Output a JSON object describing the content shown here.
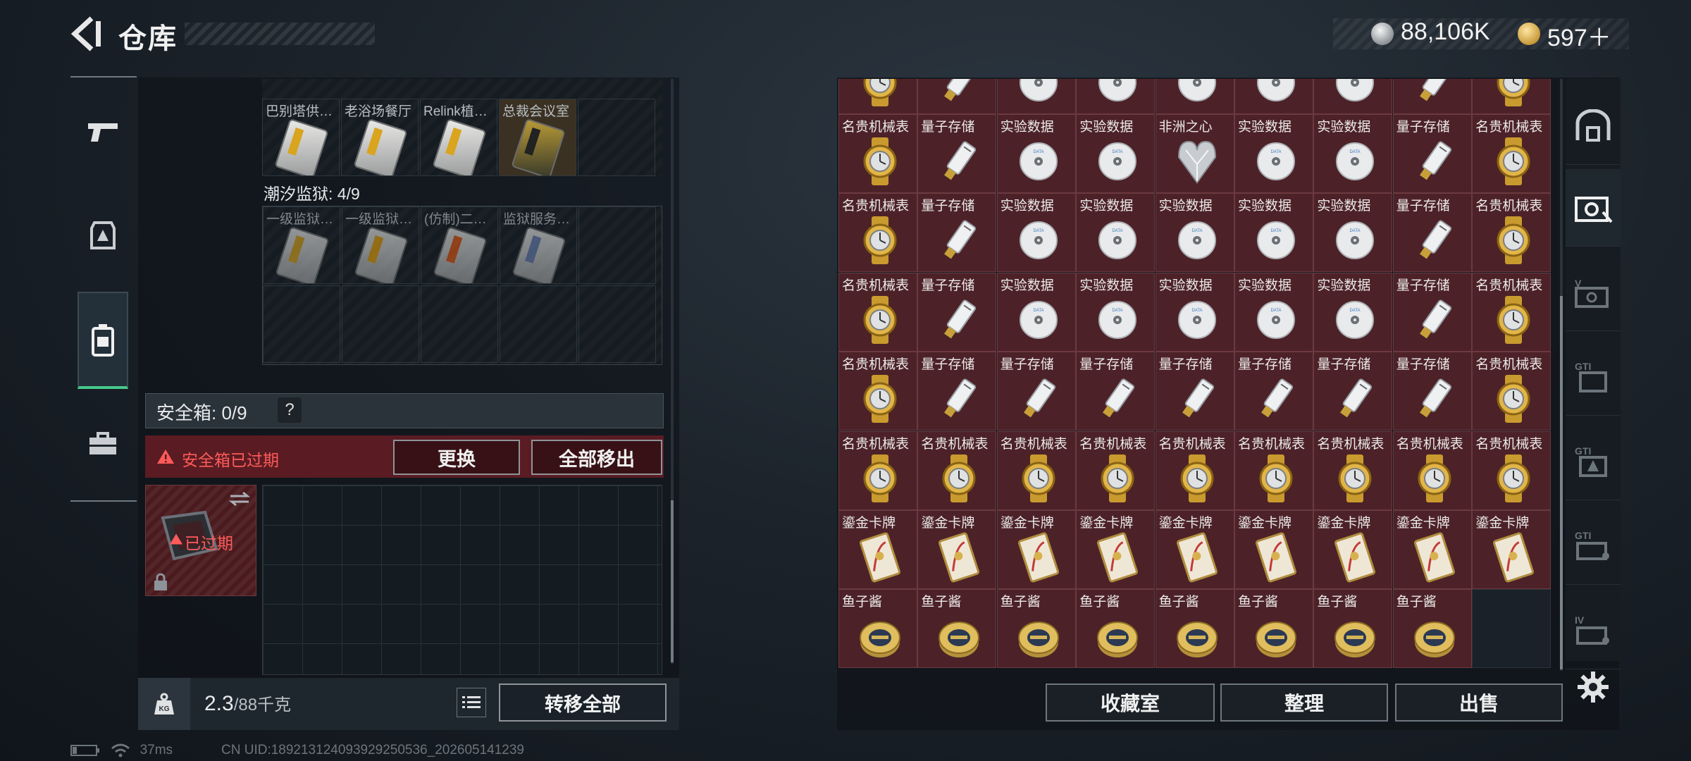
{
  "header": {
    "title": "仓库",
    "currency_silver": "88,106K",
    "currency_gold": "597＋"
  },
  "left_nav": {
    "items": [
      "weapon-icon",
      "armor-icon",
      "backpack-icon",
      "toolbox-icon"
    ],
    "active_index": 2
  },
  "storage": {
    "top_row_names": [
      "巴别塔供…",
      "老浴场餐厅",
      "Relink植…",
      "总裁会议室"
    ],
    "section_label": "潮汐监狱: 4/9",
    "prison_row_names": [
      "一级监狱…",
      "一级监狱…",
      "(仿制)二…",
      "监狱服务…"
    ]
  },
  "safebox": {
    "label": "安全箱: 0/9",
    "help": "?",
    "expired_warning": "安全箱已过期",
    "replace_button": "更换",
    "move_all_button": "全部移出",
    "item_status": "已过期"
  },
  "bottom_left": {
    "weight_value": "2.3",
    "weight_max": "/88千克",
    "transfer_all_button": "转移全部"
  },
  "status": {
    "ping": "37ms",
    "uid": "CN UID:18921312409392925053​6_202605141239"
  },
  "items_grid": {
    "rows": [
      [
        "名贵机械表",
        "量子存储",
        "实验数据",
        "实验数据",
        "非洲之心",
        "实验数据",
        "实验数据",
        "量子存储",
        "名贵机械表"
      ],
      [
        "名贵机械表",
        "量子存储",
        "实验数据",
        "实验数据",
        "实验数据",
        "实验数据",
        "实验数据",
        "量子存储",
        "名贵机械表"
      ],
      [
        "名贵机械表",
        "量子存储",
        "实验数据",
        "实验数据",
        "实验数据",
        "实验数据",
        "实验数据",
        "量子存储",
        "名贵机械表"
      ],
      [
        "名贵机械表",
        "量子存储",
        "量子存储",
        "量子存储",
        "量子存储",
        "量子存储",
        "量子存储",
        "量子存储",
        "名贵机械表"
      ],
      [
        "名贵机械表",
        "名贵机械表",
        "名贵机械表",
        "名贵机械表",
        "名贵机械表",
        "名贵机械表",
        "名贵机械表",
        "名贵机械表",
        "名贵机械表"
      ],
      [
        "鎏金卡牌",
        "鎏金卡牌",
        "鎏金卡牌",
        "鎏金卡牌",
        "鎏金卡牌",
        "鎏金卡牌",
        "鎏金卡牌",
        "鎏金卡牌",
        "鎏金卡牌"
      ],
      [
        "鱼子酱",
        "鱼子酱",
        "鱼子酱",
        "鱼子酱",
        "鱼子酱",
        "鱼子酱",
        "鱼子酱",
        "鱼子酱"
      ]
    ]
  },
  "right_buttons": {
    "collection": "收藏室",
    "sort": "整理",
    "sell": "出售"
  },
  "right_tabs": [
    "hideout-icon",
    "vault-tab-icon",
    "v-tab-icon",
    "gti-tab-icon-1",
    "gti-tab-icon-2",
    "gti-tab-icon-3",
    "iv-tab-icon"
  ],
  "colors": {
    "accent_green": "#46c98b",
    "warning_red": "#ff5a5a",
    "cell_bg": "#4c2228"
  }
}
